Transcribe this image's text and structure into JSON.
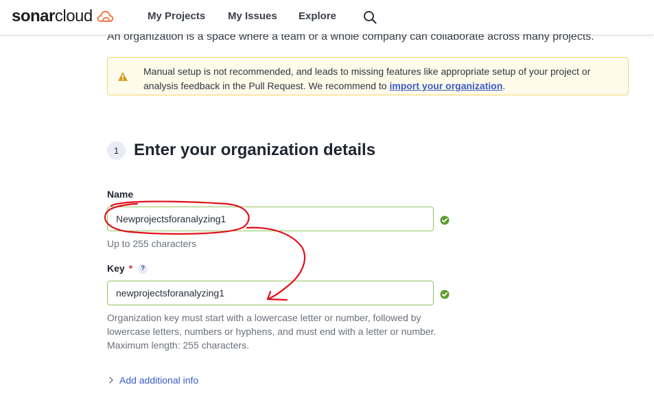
{
  "nav": {
    "logo_bold": "sonar",
    "logo_light": "cloud",
    "items": [
      {
        "label": "My Projects"
      },
      {
        "label": "My Issues"
      },
      {
        "label": "Explore"
      }
    ]
  },
  "intro": {
    "text": "An organization is a space where a team or a whole company can collaborate across many projects."
  },
  "warning": {
    "text_before": "Manual setup is not recommended, and leads to missing features like appropriate setup of your project or analysis feedback in the Pull Request. We recommend to ",
    "link": "import your organization",
    "text_after": "."
  },
  "step": {
    "number": "1",
    "title": "Enter your organization details"
  },
  "form": {
    "name_label": "Name",
    "name_value": "Newprojectsforanalyzing1",
    "name_hint": "Up to 255 characters",
    "key_label": "Key",
    "key_required": "*",
    "key_help": "?",
    "key_value": "newprojectsforanalyzing1",
    "key_hint": "Organization key must start with a lowercase letter or number, followed by lowercase letters, numbers or hyphens, and must end with a letter or number. Maximum length: 255 characters.",
    "add_info": "Add additional info"
  },
  "colors": {
    "accent": "#3a5bc7",
    "valid_border": "#93c25f",
    "valid_check": "#5d9b2e",
    "warning_bg": "#fffbea",
    "warning_border": "#f3d76a",
    "annotation_red": "#e0101a",
    "logo_orange": "#f0703a"
  }
}
